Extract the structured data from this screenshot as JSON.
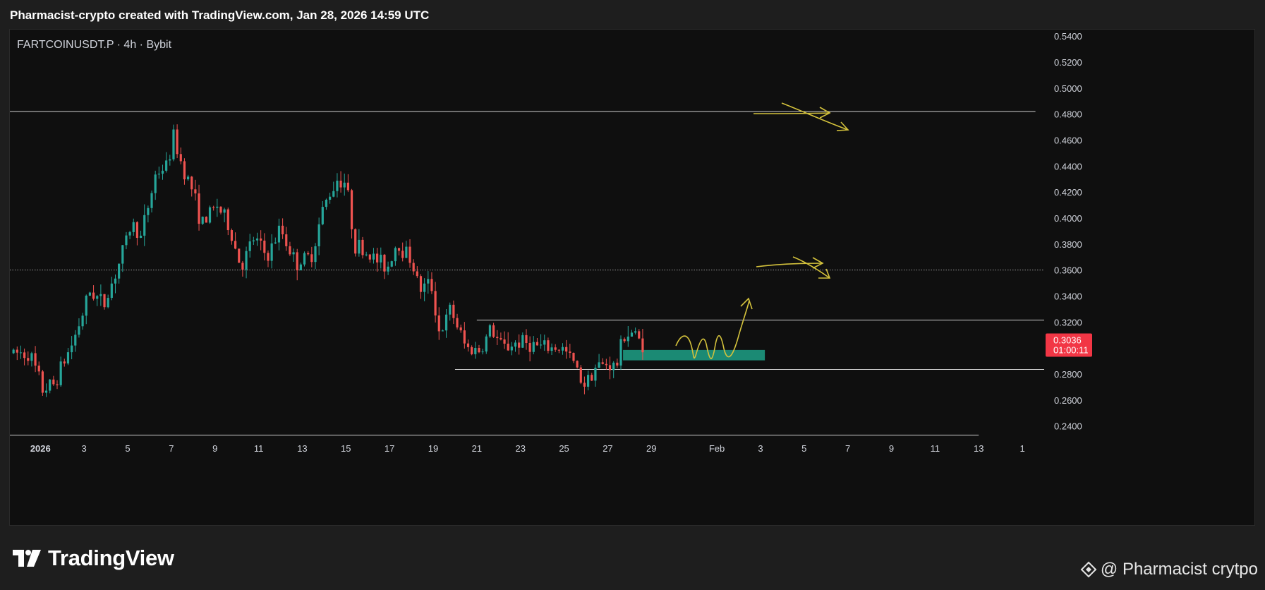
{
  "header": {
    "title": "Pharmacist-crypto created with TradingView.com, Jan 28, 2026 14:59 UTC"
  },
  "colors": {
    "background": "#0f0f0f",
    "frame": "#1e1e1e",
    "bull": "#26a69a",
    "bear": "#ef5350",
    "level_line": "#cfcfcf",
    "zone": "#1b8a74",
    "drawing": "#d4c23c",
    "price_tag": "#f23645"
  },
  "branding": {
    "logo_text": "TradingView",
    "watermark_text": "@ Pharmacist crytpo"
  },
  "chart_data": {
    "type": "candlestick",
    "symbol_label": "FARTCOINUSDT.P · 4h · Bybit",
    "symbol": "FARTCOINUSDT.P",
    "interval": "4h",
    "exchange": "Bybit",
    "grid": false,
    "y_axis": {
      "position": "right",
      "range": [
        0.23,
        0.545
      ],
      "ticks": [
        "0.5400",
        "0.5200",
        "0.5000",
        "0.4800",
        "0.4600",
        "0.4400",
        "0.4200",
        "0.4000",
        "0.3800",
        "0.3600",
        "0.3400",
        "0.3200",
        "0.2800",
        "0.2600",
        "0.2400"
      ]
    },
    "x_axis": {
      "unit": "days since Jan 1 2026 (0 = Jan 1)",
      "range": [
        -1.4,
        46
      ],
      "ticks": [
        {
          "day": 0,
          "label": "2026"
        },
        {
          "day": 2,
          "label": "3"
        },
        {
          "day": 4,
          "label": "5"
        },
        {
          "day": 6,
          "label": "7"
        },
        {
          "day": 8,
          "label": "9"
        },
        {
          "day": 10,
          "label": "11"
        },
        {
          "day": 12,
          "label": "13"
        },
        {
          "day": 14,
          "label": "15"
        },
        {
          "day": 16,
          "label": "17"
        },
        {
          "day": 18,
          "label": "19"
        },
        {
          "day": 20,
          "label": "21"
        },
        {
          "day": 22,
          "label": "23"
        },
        {
          "day": 24,
          "label": "25"
        },
        {
          "day": 26,
          "label": "27"
        },
        {
          "day": 28,
          "label": "29"
        },
        {
          "day": 31,
          "label": "Feb"
        },
        {
          "day": 33,
          "label": "3"
        },
        {
          "day": 35,
          "label": "5"
        },
        {
          "day": 37,
          "label": "7"
        },
        {
          "day": 39,
          "label": "9"
        },
        {
          "day": 41,
          "label": "11"
        },
        {
          "day": 43,
          "label": "13"
        },
        {
          "day": 45,
          "label": "1"
        }
      ]
    },
    "close_path_keypoints": [
      {
        "day": -1.4,
        "close": 0.296
      },
      {
        "day": -0.5,
        "close": 0.296
      },
      {
        "day": 0.1,
        "close": 0.268
      },
      {
        "day": 0.6,
        "close": 0.272
      },
      {
        "day": 1.5,
        "close": 0.305
      },
      {
        "day": 2.3,
        "close": 0.345
      },
      {
        "day": 2.9,
        "close": 0.333
      },
      {
        "day": 3.6,
        "close": 0.365
      },
      {
        "day": 4.2,
        "close": 0.397
      },
      {
        "day": 4.6,
        "close": 0.385
      },
      {
        "day": 5.3,
        "close": 0.435
      },
      {
        "day": 5.8,
        "close": 0.44
      },
      {
        "day": 6.1,
        "close": 0.462
      },
      {
        "day": 6.5,
        "close": 0.44
      },
      {
        "day": 6.9,
        "close": 0.425
      },
      {
        "day": 7.4,
        "close": 0.395
      },
      {
        "day": 8.1,
        "close": 0.41
      },
      {
        "day": 8.6,
        "close": 0.395
      },
      {
        "day": 9.2,
        "close": 0.362
      },
      {
        "day": 9.8,
        "close": 0.385
      },
      {
        "day": 10.4,
        "close": 0.37
      },
      {
        "day": 11.0,
        "close": 0.392
      },
      {
        "day": 11.7,
        "close": 0.365
      },
      {
        "day": 12.4,
        "close": 0.37
      },
      {
        "day": 13.0,
        "close": 0.41
      },
      {
        "day": 13.6,
        "close": 0.43
      },
      {
        "day": 14.0,
        "close": 0.428
      },
      {
        "day": 14.4,
        "close": 0.38
      },
      {
        "day": 15.2,
        "close": 0.37
      },
      {
        "day": 15.9,
        "close": 0.362
      },
      {
        "day": 16.3,
        "close": 0.38
      },
      {
        "day": 16.9,
        "close": 0.372
      },
      {
        "day": 17.4,
        "close": 0.345
      },
      {
        "day": 17.9,
        "close": 0.35
      },
      {
        "day": 18.3,
        "close": 0.31
      },
      {
        "day": 18.8,
        "close": 0.33
      },
      {
        "day": 19.5,
        "close": 0.3
      },
      {
        "day": 20.2,
        "close": 0.298
      },
      {
        "day": 20.6,
        "close": 0.315
      },
      {
        "day": 21.2,
        "close": 0.3
      },
      {
        "day": 22.0,
        "close": 0.305
      },
      {
        "day": 23.0,
        "close": 0.3
      },
      {
        "day": 23.9,
        "close": 0.3
      },
      {
        "day": 24.4,
        "close": 0.29
      },
      {
        "day": 24.9,
        "close": 0.272
      },
      {
        "day": 25.4,
        "close": 0.285
      },
      {
        "day": 26.0,
        "close": 0.288
      },
      {
        "day": 26.4,
        "close": 0.285
      },
      {
        "day": 26.7,
        "close": 0.31
      },
      {
        "day": 27.1,
        "close": 0.312
      },
      {
        "day": 27.6,
        "close": 0.3036
      }
    ],
    "horizontal_levels": [
      {
        "price": 0.482,
        "style": "solid",
        "from_day": -1.4,
        "to_day": 45.6
      },
      {
        "price": 0.36,
        "style": "dotted",
        "from_day": -1.4,
        "to_day": 46
      },
      {
        "price": 0.3215,
        "style": "solid",
        "from_day": 20.0,
        "to_day": 46
      },
      {
        "price": 0.2835,
        "style": "solid",
        "from_day": 19.0,
        "to_day": 46
      },
      {
        "price": 0.233,
        "style": "solid",
        "from_day": -1.4,
        "to_day": 43.0
      }
    ],
    "zone": {
      "from_day": 26.7,
      "to_day": 33.2,
      "price_low": 0.2905,
      "price_high": 0.2985
    },
    "last_price": {
      "value": "0.3036",
      "countdown": "01:00:11"
    }
  }
}
